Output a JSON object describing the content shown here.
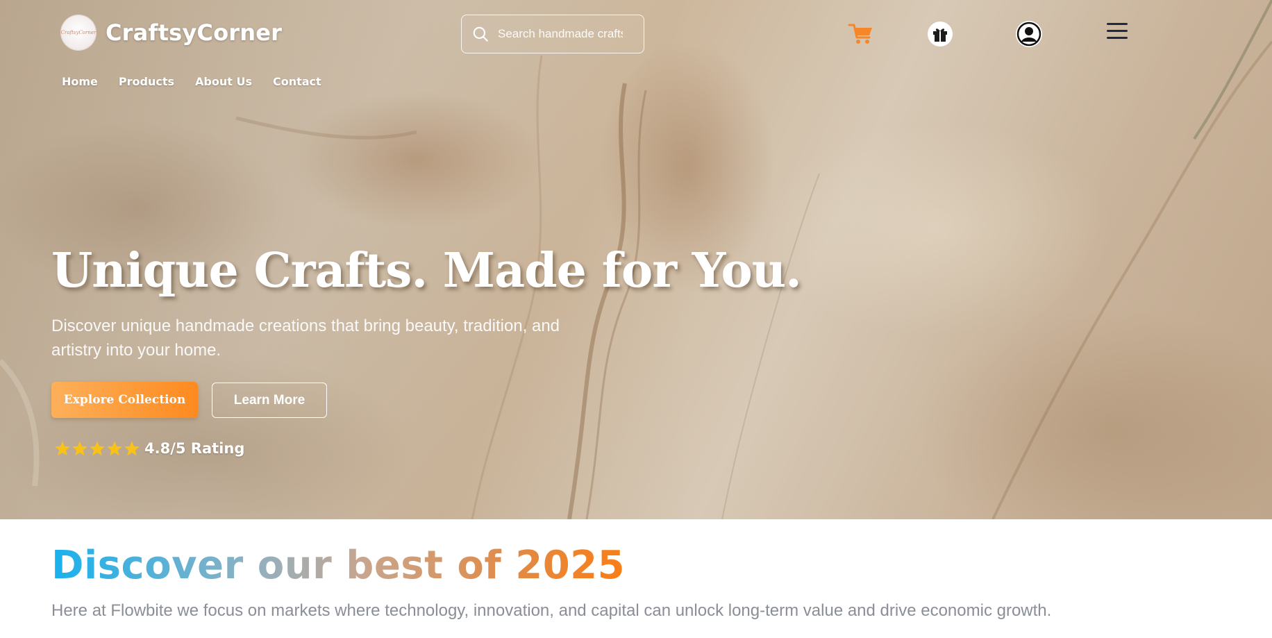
{
  "brand": {
    "name": "CraftsyCorner",
    "logo_text": "CraftsyCorner"
  },
  "nav": {
    "items": [
      "Home",
      "Products",
      "About Us",
      "Contact"
    ]
  },
  "search": {
    "placeholder": "Search handmade crafts"
  },
  "header_icons": [
    "cart-icon",
    "gift-icon",
    "user-icon",
    "menu-icon"
  ],
  "hero": {
    "title": "Unique Crafts. Made for You.",
    "subtitle": "Discover unique handmade creations that bring beauty, tradition, and artistry into your home.",
    "primary_button": "Explore Collection",
    "secondary_button": "Learn More",
    "rating": {
      "stars": 5,
      "text": "4.8/5 Rating"
    }
  },
  "discover": {
    "title": "Discover our best of 2025",
    "description": "Here at Flowbite we focus on markets where technology, innovation, and capital can unlock long-term value and drive economic growth."
  },
  "colors": {
    "accent_orange": "#fd8a1f",
    "cart_orange": "#f5862a",
    "star_gold": "#f8c21a",
    "title_blue": "#18b1ee",
    "text_gray": "#8a8e96",
    "icon_navy": "#1e2a44"
  }
}
